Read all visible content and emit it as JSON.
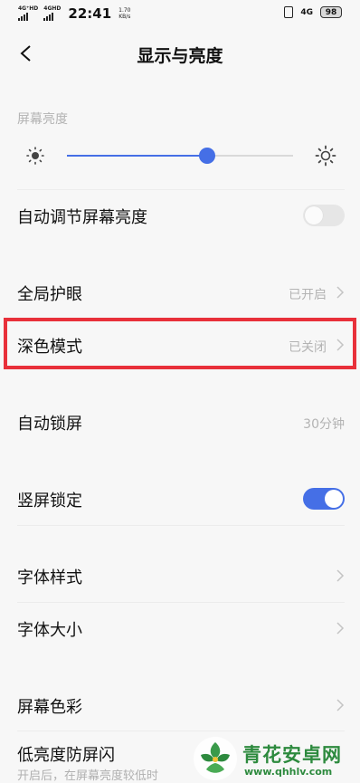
{
  "status_bar": {
    "sim1": "4G⁺HD",
    "sim2": "4GHD",
    "time": "22:41",
    "speed_value": "1.70",
    "speed_unit": "KB/s",
    "network": "4G",
    "battery": "98"
  },
  "header": {
    "title": "显示与亮度",
    "back_icon": "chevron-left-icon"
  },
  "brightness": {
    "section_label": "屏幕亮度",
    "level": 0.62,
    "low_icon": "sun-small-icon",
    "high_icon": "sun-large-icon"
  },
  "rows": {
    "auto_brightness": {
      "label": "自动调节屏幕亮度",
      "toggle": false
    },
    "eye_care": {
      "label": "全局护眼",
      "value": "已开启"
    },
    "dark_mode": {
      "label": "深色模式",
      "value": "已关闭"
    },
    "auto_lock": {
      "label": "自动锁屏",
      "value": "30分钟"
    },
    "portrait_lock": {
      "label": "竖屏锁定",
      "toggle": true
    },
    "font_style": {
      "label": "字体样式"
    },
    "font_size": {
      "label": "字体大小"
    },
    "screen_color": {
      "label": "屏幕色彩"
    },
    "anti_flicker": {
      "label": "低亮度防屏闪",
      "description": "开启后，在屏幕亮度较低时"
    }
  },
  "watermark": {
    "brand": "青花安卓网",
    "url": "www.qhhlv.com",
    "icon": "flower-logo-icon"
  },
  "colors": {
    "accent": "#456fe6",
    "highlight": "#e8303a",
    "watermark": "#2d8a3e"
  }
}
